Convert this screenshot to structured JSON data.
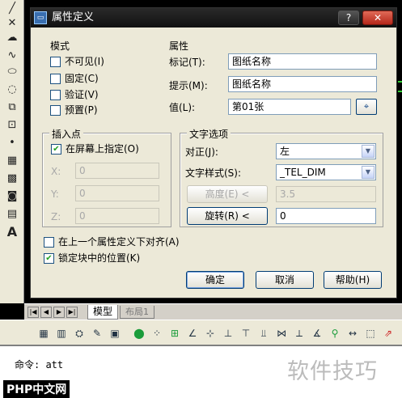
{
  "dialog": {
    "title": "属性定义",
    "help_button": "?",
    "close_button": "✕",
    "mode": {
      "title": "模式",
      "invisible": "不可见(I)",
      "constant": "固定(C)",
      "verify": "验证(V)",
      "preset": "预置(P)"
    },
    "attribute": {
      "title": "属性",
      "tag_label": "标记(T):",
      "tag_value": "图纸名称",
      "prompt_label": "提示(M):",
      "prompt_value": "图纸名称",
      "value_label": "值(L):",
      "value_value": "第01张"
    },
    "insertion": {
      "title": "插入点",
      "specify_on_screen": "在屏幕上指定(O)",
      "x_label": "X:",
      "x_value": "0",
      "y_label": "Y:",
      "y_value": "0",
      "z_label": "Z:",
      "z_value": "0"
    },
    "text_options": {
      "title": "文字选项",
      "justify_label": "对正(J):",
      "justify_value": "左",
      "style_label": "文字样式(S):",
      "style_value": "_TEL_DIM",
      "height_button": "高度(E) <",
      "height_value": "3.5",
      "rotation_button": "旋转(R) <",
      "rotation_value": "0"
    },
    "align_below": "在上一个属性定义下对齐(A)",
    "lock_position": "锁定块中的位置(K)",
    "ok": "确定",
    "cancel": "取消",
    "help": "帮助(H)"
  },
  "tabs": {
    "model": "模型",
    "layout": "布局1"
  },
  "command": {
    "text": "命令: att"
  },
  "watermark": "软件技巧",
  "logo": "PHP中文网"
}
